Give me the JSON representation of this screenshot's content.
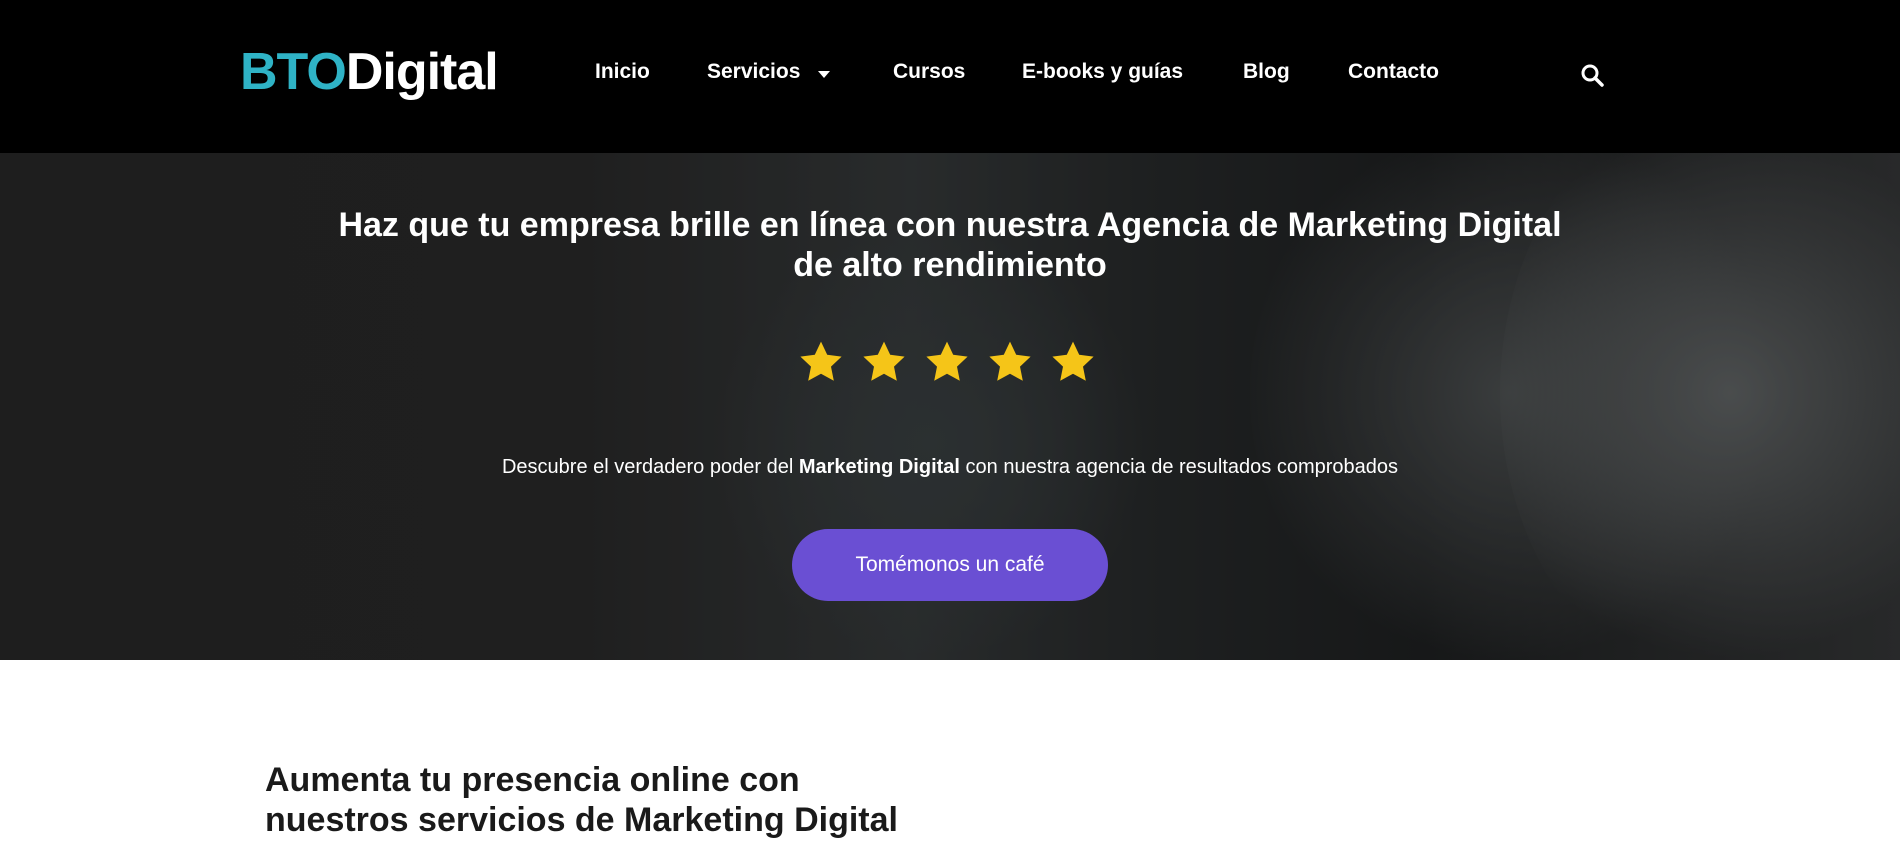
{
  "header": {
    "logo": {
      "part1": "BTO",
      "part2": "Digital"
    },
    "nav": [
      {
        "label": "Inicio"
      },
      {
        "label": "Servicios",
        "has_dropdown": true
      },
      {
        "label": "Cursos"
      },
      {
        "label": "E-books y guías"
      },
      {
        "label": "Blog"
      },
      {
        "label": "Contacto"
      }
    ],
    "search_icon": "search-icon"
  },
  "hero": {
    "title_line1": "Haz que tu empresa brille en línea con nuestra Agencia de Marketing Digital",
    "title_line2": "de alto rendimiento",
    "rating": 5,
    "rating_max": 5,
    "subtitle_before": "Descubre el verdadero poder del ",
    "subtitle_bold": "Marketing Digital",
    "subtitle_after": " con nuestra agencia de resultados comprobados",
    "cta_label": "Tomémonos un café"
  },
  "section": {
    "title_line1": "Aumenta tu presencia online con",
    "title_line2": "nuestros servicios de Marketing Digital"
  },
  "colors": {
    "brand_cyan": "#2fb3c6",
    "cta_purple": "#6a4fd3",
    "star_yellow": "#f5c518",
    "topbar_black": "#000000"
  }
}
